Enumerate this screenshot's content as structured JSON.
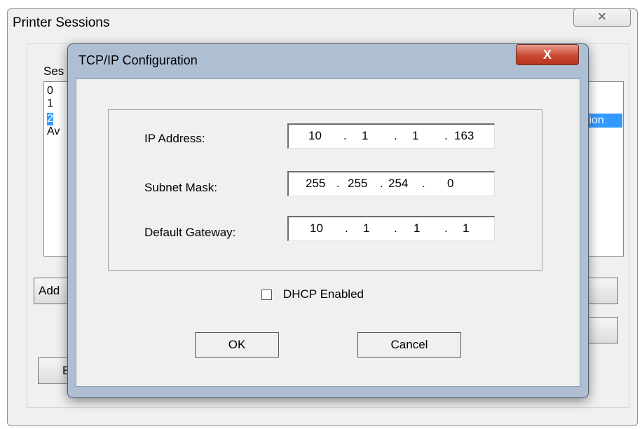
{
  "background_window": {
    "title": "Printer Sessions",
    "close_glyph": "✕",
    "group_label": "Ses",
    "list_items": [
      "0",
      "1",
      "2",
      "Av"
    ],
    "selected_item_suffix": "tion",
    "add_button_label": "Add",
    "bottom_button_label": "E"
  },
  "dialog": {
    "title": "TCP/IP Configuration",
    "close_glyph": "X",
    "ip_address": {
      "label": "IP Address:",
      "octets": [
        "10",
        "1",
        "1",
        "163"
      ]
    },
    "subnet_mask": {
      "label": "Subnet Mask:",
      "octets": [
        "255",
        "255",
        "254",
        "0"
      ]
    },
    "default_gateway": {
      "label": "Default Gateway:",
      "octets": [
        "10",
        "1",
        "1",
        "1"
      ]
    },
    "separator": ".",
    "dhcp": {
      "label": "DHCP Enabled",
      "checked": false
    },
    "ok_label": "OK",
    "cancel_label": "Cancel"
  },
  "colors": {
    "selection": "#3399ff",
    "dialog_frame": "#aebfd3",
    "close_button": "#c94a33"
  }
}
